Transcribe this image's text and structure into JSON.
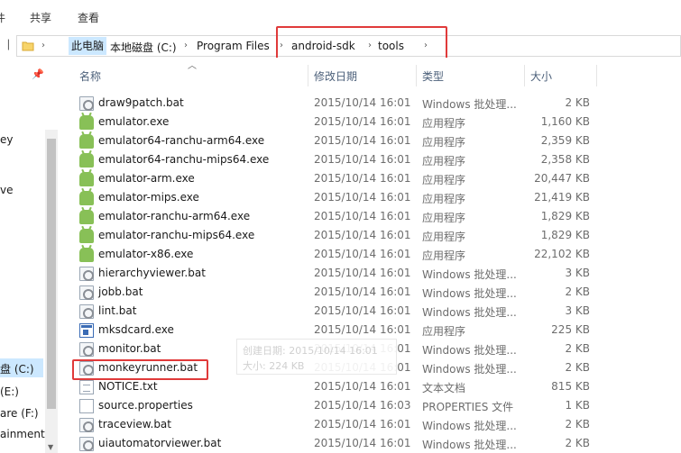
{
  "ribbon": {
    "tabs": [
      "件",
      "共享",
      "查看"
    ]
  },
  "address": {
    "crumbs": [
      "此电脑",
      "本地磁盘 (C:)",
      "Program Files",
      "android-sdk",
      "tools"
    ]
  },
  "nav": {
    "items": [
      "ey",
      "ve",
      "盘 (C:)",
      "(E:)",
      "are (F:)",
      "ainment"
    ]
  },
  "columns": {
    "name": "名称",
    "date": "修改日期",
    "type": "类型",
    "size": "大小"
  },
  "files": [
    {
      "name": "draw9patch.bat",
      "date": "2015/10/14 16:01",
      "type": "Windows 批处理...",
      "size": "2 KB",
      "icon": "bat-file-icon"
    },
    {
      "name": "emulator.exe",
      "date": "2015/10/14 16:01",
      "type": "应用程序",
      "size": "1,160 KB",
      "icon": "android-exe-icon"
    },
    {
      "name": "emulator64-ranchu-arm64.exe",
      "date": "2015/10/14 16:01",
      "type": "应用程序",
      "size": "2,359 KB",
      "icon": "android-exe-icon"
    },
    {
      "name": "emulator64-ranchu-mips64.exe",
      "date": "2015/10/14 16:01",
      "type": "应用程序",
      "size": "2,358 KB",
      "icon": "android-exe-icon"
    },
    {
      "name": "emulator-arm.exe",
      "date": "2015/10/14 16:01",
      "type": "应用程序",
      "size": "20,447 KB",
      "icon": "android-exe-icon"
    },
    {
      "name": "emulator-mips.exe",
      "date": "2015/10/14 16:01",
      "type": "应用程序",
      "size": "21,419 KB",
      "icon": "android-exe-icon"
    },
    {
      "name": "emulator-ranchu-arm64.exe",
      "date": "2015/10/14 16:01",
      "type": "应用程序",
      "size": "1,829 KB",
      "icon": "android-exe-icon"
    },
    {
      "name": "emulator-ranchu-mips64.exe",
      "date": "2015/10/14 16:01",
      "type": "应用程序",
      "size": "1,829 KB",
      "icon": "android-exe-icon"
    },
    {
      "name": "emulator-x86.exe",
      "date": "2015/10/14 16:01",
      "type": "应用程序",
      "size": "22,102 KB",
      "icon": "android-exe-icon"
    },
    {
      "name": "hierarchyviewer.bat",
      "date": "2015/10/14 16:01",
      "type": "Windows 批处理...",
      "size": "3 KB",
      "icon": "bat-file-icon"
    },
    {
      "name": "jobb.bat",
      "date": "2015/10/14 16:01",
      "type": "Windows 批处理...",
      "size": "2 KB",
      "icon": "bat-file-icon"
    },
    {
      "name": "lint.bat",
      "date": "2015/10/14 16:01",
      "type": "Windows 批处理...",
      "size": "3 KB",
      "icon": "bat-file-icon"
    },
    {
      "name": "mksdcard.exe",
      "date": "2015/10/14 16:01",
      "type": "应用程序",
      "size": "225 KB",
      "icon": "window-exe-icon"
    },
    {
      "name": "monitor.bat",
      "date": "2015/10/14 16:01",
      "type": "Windows 批处理...",
      "size": "2 KB",
      "icon": "bat-file-icon"
    },
    {
      "name": "monkeyrunner.bat",
      "date": "2015/10/14 16:01",
      "type": "Windows 批处理...",
      "size": "2 KB",
      "icon": "bat-file-icon"
    },
    {
      "name": "NOTICE.txt",
      "date": "2015/10/14 16:01",
      "type": "文本文档",
      "size": "815 KB",
      "icon": "text-file-icon"
    },
    {
      "name": "source.properties",
      "date": "2015/10/14 16:03",
      "type": "PROPERTIES 文件",
      "size": "1 KB",
      "icon": "properties-file-icon"
    },
    {
      "name": "traceview.bat",
      "date": "2015/10/14 16:01",
      "type": "Windows 批处理...",
      "size": "2 KB",
      "icon": "bat-file-icon"
    },
    {
      "name": "uiautomatorviewer.bat",
      "date": "2015/10/14 16:01",
      "type": "Windows 批处理...",
      "size": "2 KB",
      "icon": "bat-file-icon"
    }
  ],
  "tooltip": {
    "line1": "创建日期: 2015/10/14 16:01",
    "line2": "大小: 224 KB"
  },
  "colors": {
    "highlight": "#e03a3a",
    "selection": "#cce8ff"
  }
}
